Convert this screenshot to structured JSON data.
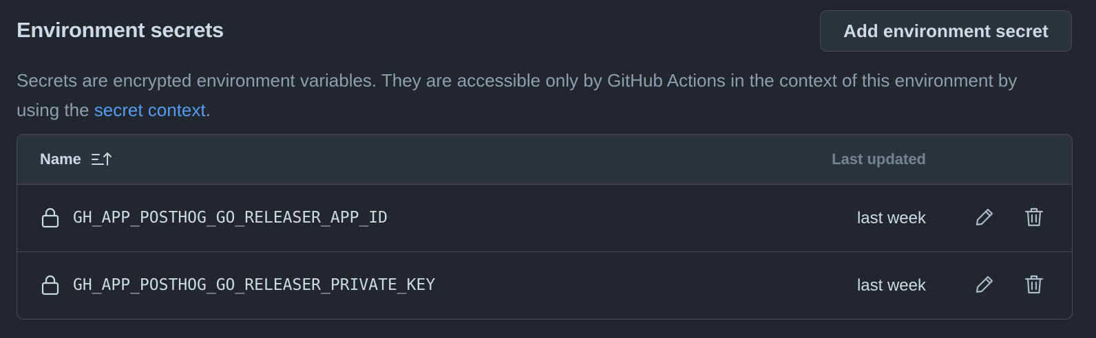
{
  "header": {
    "title": "Environment secrets",
    "add_button_label": "Add environment secret"
  },
  "description": {
    "text_before": "Secrets are encrypted environment variables. They are accessible only by GitHub Actions in the context of this environment by using the ",
    "link_text": "secret context",
    "text_after": "."
  },
  "table": {
    "columns": {
      "name": "Name",
      "last_updated": "Last updated"
    },
    "rows": [
      {
        "name": "GH_APP_POSTHOG_GO_RELEASER_APP_ID",
        "last_updated": "last week"
      },
      {
        "name": "GH_APP_POSTHOG_GO_RELEASER_PRIVATE_KEY",
        "last_updated": "last week"
      }
    ]
  },
  "icons": {
    "sort": "sort-ascending-icon",
    "lock": "lock-icon",
    "edit": "pencil-icon",
    "delete": "trash-icon"
  },
  "colors": {
    "background": "#22272e",
    "header_background": "#2d333b",
    "border": "#444c56",
    "text_primary": "#cdd9e5",
    "text_muted": "#909dab",
    "link": "#539bf5"
  }
}
